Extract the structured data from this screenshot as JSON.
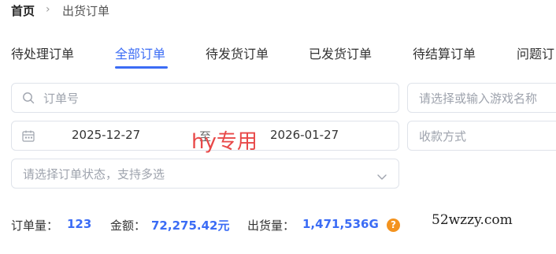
{
  "breadcrumb": {
    "home": "首页",
    "separator": "›",
    "current": "出货订单"
  },
  "tabs": [
    {
      "label": "待处理订单",
      "active": false
    },
    {
      "label": "全部订单",
      "active": true
    },
    {
      "label": "待发货订单",
      "active": false
    },
    {
      "label": "已发货订单",
      "active": false
    },
    {
      "label": "待结算订单",
      "active": false
    },
    {
      "label": "问题订",
      "active": false
    }
  ],
  "filters": {
    "order_no_placeholder": "订单号",
    "game_placeholder": "请选择或输入游戏名称",
    "date_start": "2025-12-27",
    "date_separator": "至",
    "date_end": "2026-01-27",
    "payment_placeholder": "收款方式",
    "status_placeholder": "请选择订单状态，支持多选"
  },
  "stats": {
    "order_count_label": "订单量：",
    "order_count": "123",
    "amount_label": "金额：",
    "amount": "72,275.42元",
    "shipped_label": "出货量：",
    "shipped": "1,471,536G",
    "help_icon": "?"
  },
  "watermarks": {
    "overlay": "hy专用",
    "site": "52wzzy.com"
  },
  "colors": {
    "accent": "#3b6cf5",
    "help": "#f3931f",
    "overlay": "#e84848"
  }
}
